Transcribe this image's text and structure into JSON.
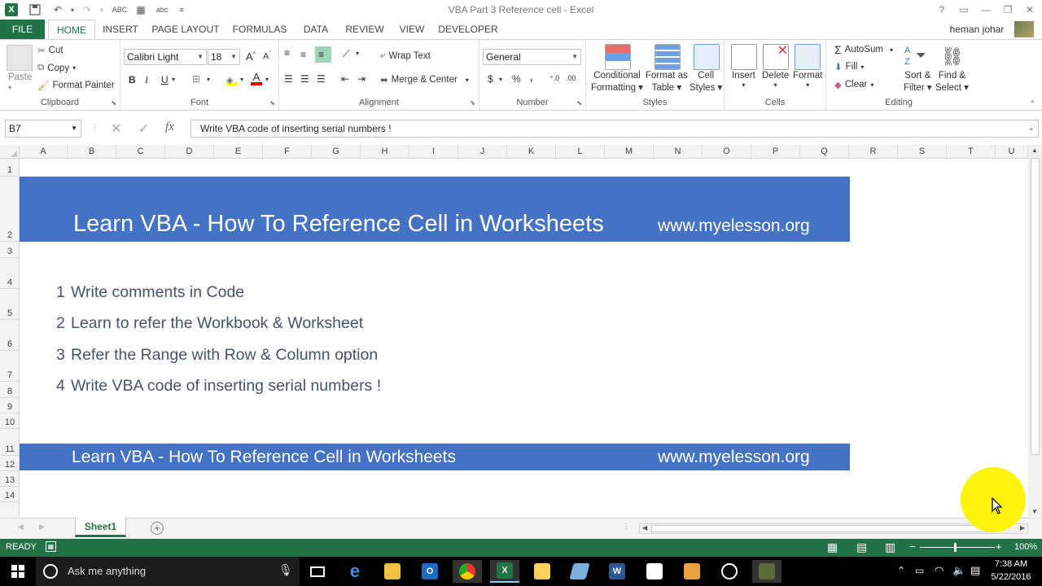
{
  "window": {
    "title": "VBA Part 3 Reference cell - Excel",
    "user": "heman johar"
  },
  "ribbon_tabs": [
    "FILE",
    "HOME",
    "INSERT",
    "PAGE LAYOUT",
    "FORMULAS",
    "DATA",
    "REVIEW",
    "VIEW",
    "DEVELOPER"
  ],
  "clipboard": {
    "paste": "Paste",
    "cut": "Cut",
    "copy": "Copy",
    "format_painter": "Format Painter",
    "label": "Clipboard"
  },
  "font": {
    "name": "Calibri Light",
    "size": "18",
    "label": "Font",
    "bold": "B",
    "italic": "I",
    "underline": "U"
  },
  "alignment": {
    "wrap_text": "Wrap Text",
    "merge_center": "Merge & Center",
    "label": "Alignment"
  },
  "number": {
    "format": "General",
    "label": "Number",
    "currency": "$",
    "percent": "%",
    "comma": ","
  },
  "styles": {
    "conditional_1": "Conditional",
    "conditional_2": "Formatting",
    "format_table_1": "Format as",
    "format_table_2": "Table",
    "cell_styles_1": "Cell",
    "cell_styles_2": "Styles",
    "label": "Styles"
  },
  "cells": {
    "insert": "Insert",
    "delete": "Delete",
    "format": "Format",
    "label": "Cells"
  },
  "editing": {
    "autosum": "AutoSum",
    "fill": "Fill",
    "clear": "Clear",
    "sort_1": "Sort &",
    "sort_2": "Filter",
    "find_1": "Find &",
    "find_2": "Select",
    "label": "Editing"
  },
  "formula_bar": {
    "name_box": "B7",
    "fx": "fx",
    "content": "Write VBA code of inserting serial numbers !"
  },
  "columns": [
    "A",
    "B",
    "C",
    "D",
    "E",
    "F",
    "G",
    "H",
    "I",
    "J",
    "K",
    "L",
    "M",
    "N",
    "O",
    "P",
    "Q",
    "R",
    "S",
    "T",
    "U"
  ],
  "rows": [
    "1",
    "2",
    "3",
    "4",
    "5",
    "6",
    "7",
    "8",
    "9",
    "10",
    "11",
    "12",
    "13",
    "14"
  ],
  "sheet": {
    "banner_title": "Learn VBA - How To Reference Cell in Worksheets",
    "banner_site": "www.myelesson.org",
    "list": [
      {
        "num": "1",
        "text": "Write comments in Code"
      },
      {
        "num": "2",
        "text": "Learn to refer the Workbook & Worksheet"
      },
      {
        "num": "3",
        "text": "Refer the Range with Row & Column option"
      },
      {
        "num": "4",
        "text": "Write VBA code of inserting serial numbers !"
      }
    ],
    "footer_title": "Learn VBA - How To Reference Cell in Worksheets",
    "footer_site": "www.myelesson.org"
  },
  "sheet_tabs": {
    "active": "Sheet1"
  },
  "status": {
    "mode": "READY",
    "zoom": "100%"
  },
  "taskbar": {
    "search_placeholder": "Ask me anything",
    "time": "7:38 AM",
    "date": "5/22/2016"
  },
  "colors": {
    "excel_green": "#217346",
    "banner_blue": "#4472c4",
    "list_text": "#44546a"
  }
}
